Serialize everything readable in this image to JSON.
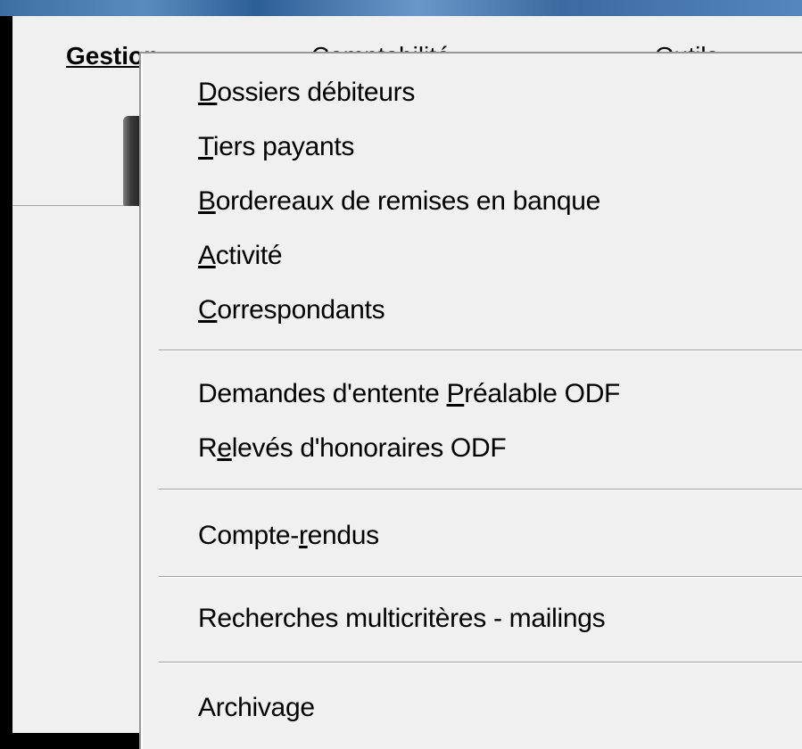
{
  "menubar": {
    "items": [
      {
        "label": "Gestion"
      },
      {
        "label": "Comptabilité"
      },
      {
        "label": "Outils"
      }
    ]
  },
  "menu": {
    "groups": [
      [
        {
          "pre": "",
          "u": "D",
          "post": "ossiers débiteurs"
        },
        {
          "pre": "",
          "u": "T",
          "post": "iers payants"
        },
        {
          "pre": "",
          "u": "B",
          "post": "ordereaux de remises en banque"
        },
        {
          "pre": "",
          "u": "A",
          "post": "ctivité"
        },
        {
          "pre": "",
          "u": "C",
          "post": "orrespondants"
        }
      ],
      [
        {
          "pre": "Demandes d'entente ",
          "u": "P",
          "post": "réalable ODF"
        },
        {
          "pre": "R",
          "u": "e",
          "post": "levés d'honoraires ODF"
        }
      ],
      [
        {
          "pre": "Compte-",
          "u": "r",
          "post": "endus"
        }
      ],
      [
        {
          "pre": "Recherches multicritères - mailings",
          "u": "",
          "post": ""
        }
      ],
      [
        {
          "pre": "Archiva",
          "u": "g",
          "post": "e"
        }
      ]
    ]
  }
}
